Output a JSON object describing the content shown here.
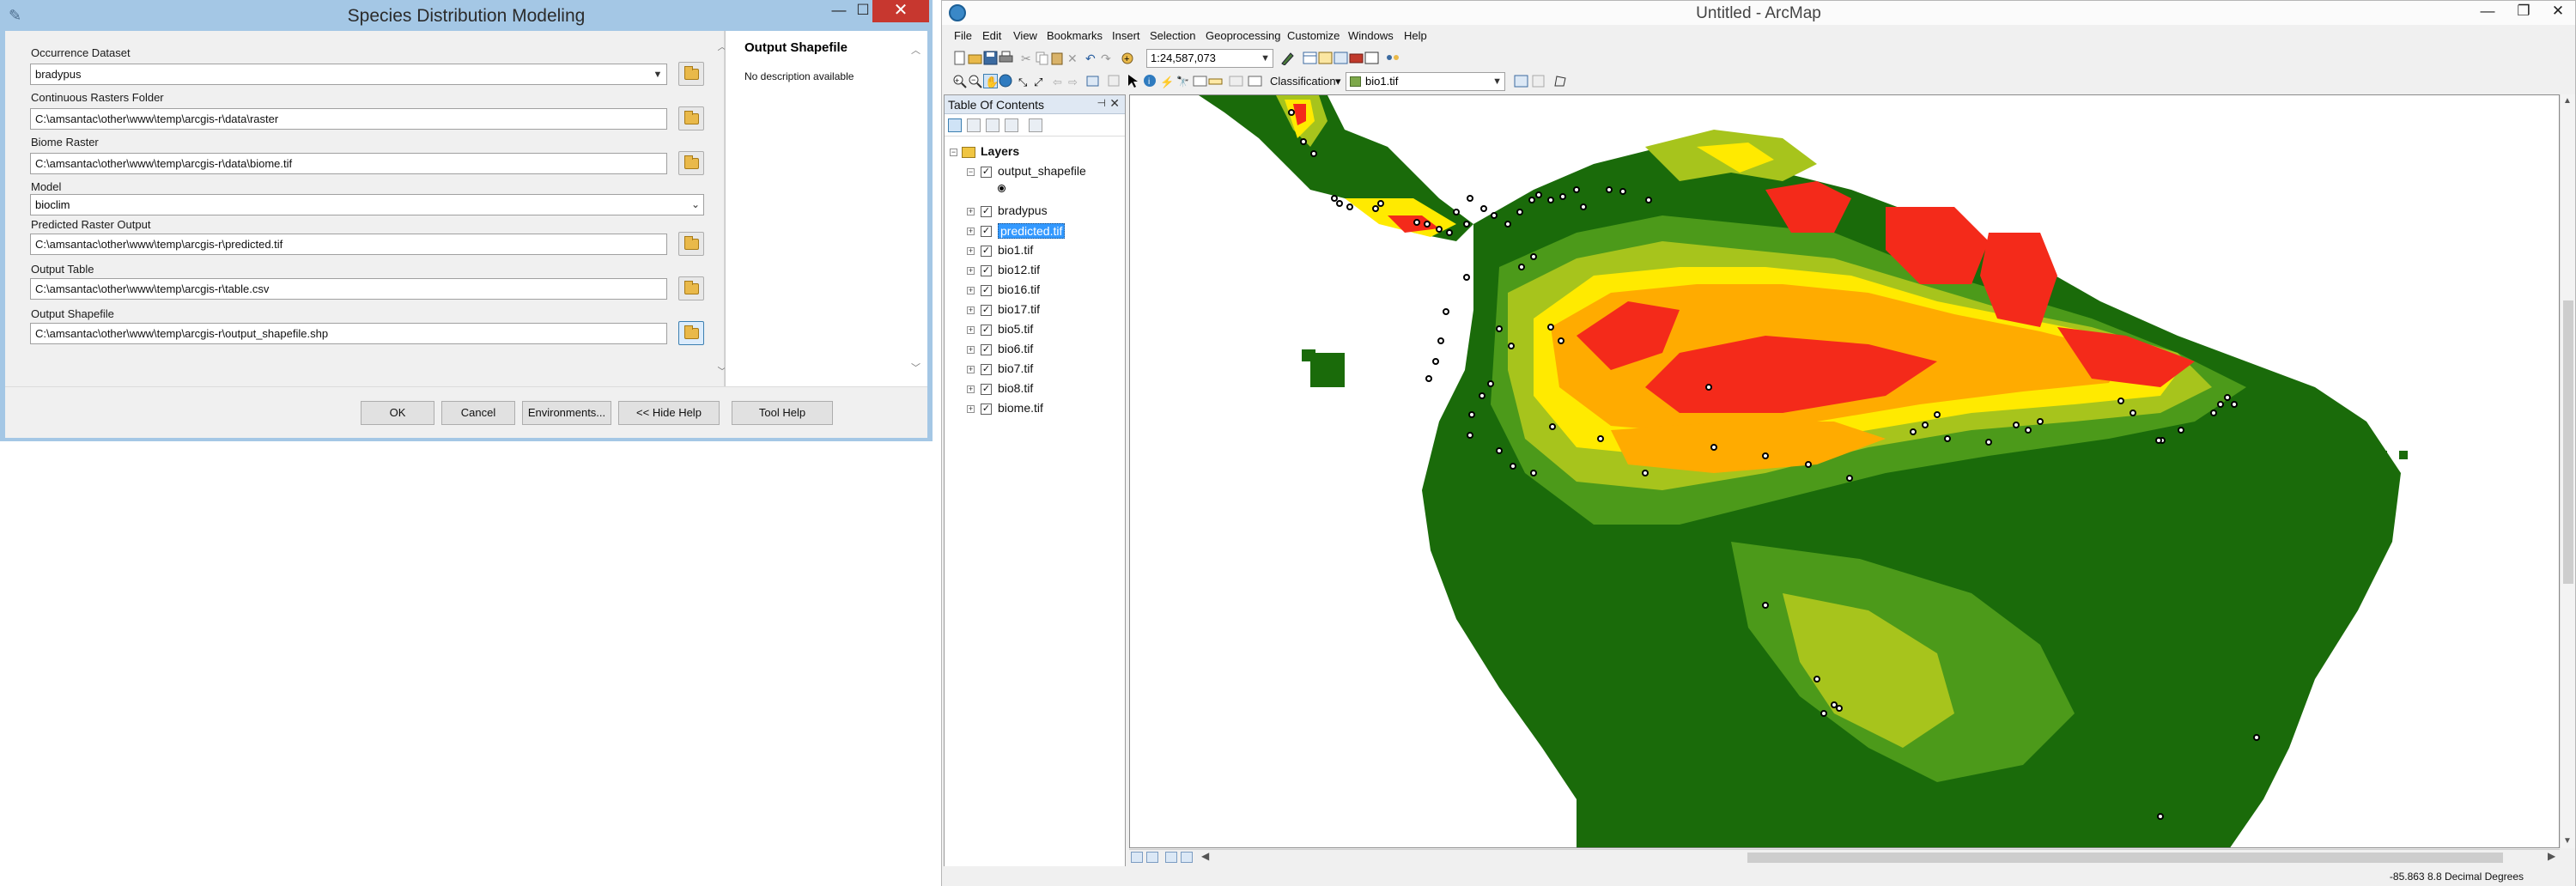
{
  "dialog": {
    "title": "Species Distribution Modeling",
    "fields": {
      "occurrence_label": "Occurrence Dataset",
      "occurrence_value": "bradypus",
      "rasters_label": "Continuous Rasters Folder",
      "rasters_value": "C:\\amsantac\\other\\www\\temp\\arcgis-r\\data\\raster",
      "biome_label": "Biome Raster",
      "biome_value": "C:\\amsantac\\other\\www\\temp\\arcgis-r\\data\\biome.tif",
      "model_label": "Model",
      "model_value": "bioclim",
      "predicted_label": "Predicted Raster Output",
      "predicted_value": "C:\\amsantac\\other\\www\\temp\\arcgis-r\\predicted.tif",
      "table_label": "Output Table",
      "table_value": "C:\\amsantac\\other\\www\\temp\\arcgis-r\\table.csv",
      "shapefile_label": "Output Shapefile",
      "shapefile_value": "C:\\amsantac\\other\\www\\temp\\arcgis-r\\output_shapefile.shp"
    },
    "help": {
      "title": "Output Shapefile",
      "description": "No description available"
    },
    "buttons": {
      "ok": "OK",
      "cancel": "Cancel",
      "environments": "Environments...",
      "hide_help": "<< Hide Help",
      "tool_help": "Tool Help"
    }
  },
  "arcmap": {
    "title": "Untitled - ArcMap",
    "menu": [
      "File",
      "Edit",
      "View",
      "Bookmarks",
      "Insert",
      "Selection",
      "Geoprocessing",
      "Customize",
      "Windows",
      "Help"
    ],
    "scale": "1:24,587,073",
    "classification_label": "Classification",
    "active_layer": "bio1.tif",
    "toc": {
      "title": "Table Of Contents",
      "root": "Layers",
      "layers": [
        {
          "name": "output_shapefile",
          "expanded": true,
          "selected": false
        },
        {
          "name": "bradypus",
          "expanded": false,
          "selected": false
        },
        {
          "name": "predicted.tif",
          "expanded": false,
          "selected": true
        },
        {
          "name": "bio1.tif",
          "expanded": false,
          "selected": false
        },
        {
          "name": "bio12.tif",
          "expanded": false,
          "selected": false
        },
        {
          "name": "bio16.tif",
          "expanded": false,
          "selected": false
        },
        {
          "name": "bio17.tif",
          "expanded": false,
          "selected": false
        },
        {
          "name": "bio5.tif",
          "expanded": false,
          "selected": false
        },
        {
          "name": "bio6.tif",
          "expanded": false,
          "selected": false
        },
        {
          "name": "bio7.tif",
          "expanded": false,
          "selected": false
        },
        {
          "name": "bio8.tif",
          "expanded": false,
          "selected": false
        },
        {
          "name": "biome.tif",
          "expanded": false,
          "selected": false
        }
      ]
    },
    "status": {
      "coordinates": "-85.863  8.8 Decimal Degrees"
    },
    "map_colors": {
      "background": "#ffffff",
      "low": "#1a6b0a",
      "mid_low": "#4c9a1a",
      "mid": "#a7c41c",
      "high": "#ffea00",
      "higher": "#ffab00",
      "highest": "#f42a1a"
    }
  }
}
